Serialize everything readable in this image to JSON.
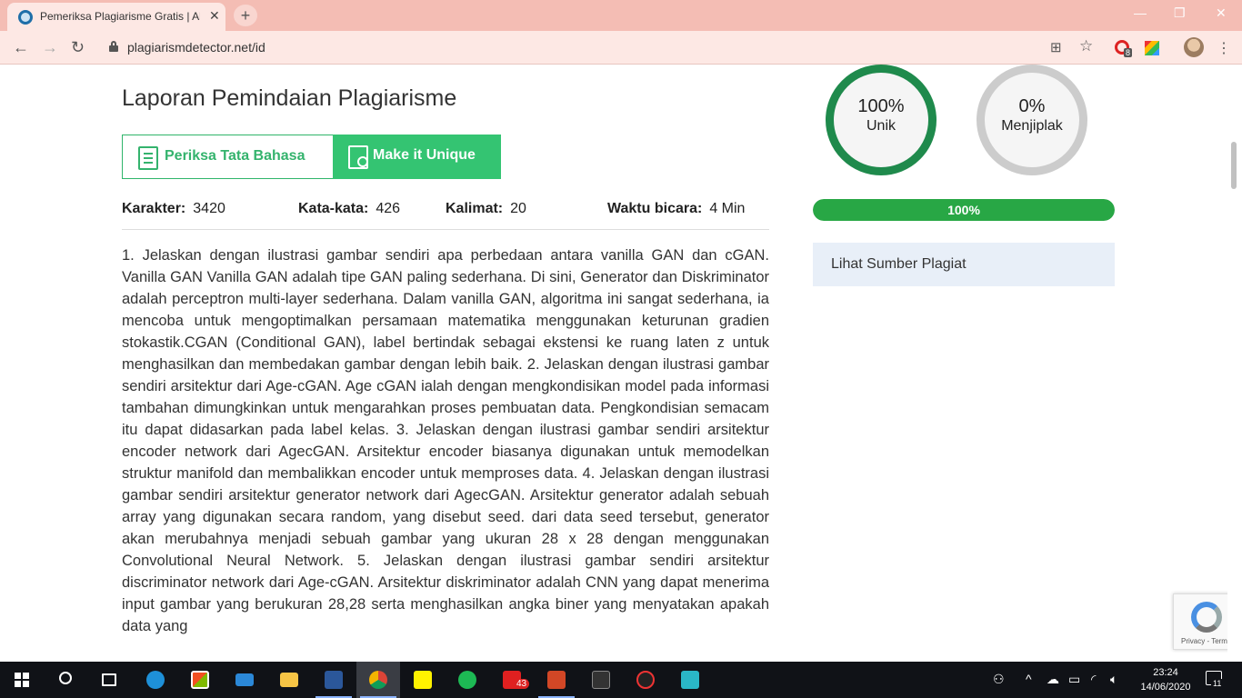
{
  "browser": {
    "tab_title": "Pemeriksa Plagiarisme Gratis | Akurat",
    "tab_close": "✕",
    "new_tab": "+",
    "url": "plagiarismdetector.net/id",
    "ext_badge": "8",
    "back": "←",
    "forward": "→",
    "reload": "↻",
    "star": "☆",
    "translate": "⊞",
    "kebab": "⋮",
    "min": "—",
    "max": "❐",
    "close": "✕"
  },
  "report": {
    "title": "Laporan Pemindaian Plagiarisme",
    "btn_grammar": "Periksa Tata Bahasa",
    "btn_unique": "Make it Unique",
    "stats": [
      {
        "label": "Karakter:",
        "value": "3420"
      },
      {
        "label": "Kata-kata:",
        "value": "426"
      },
      {
        "label": "Kalimat:",
        "value": "20"
      },
      {
        "label": "Waktu bicara:",
        "value": "4 Min"
      }
    ],
    "text": "1. Jelaskan dengan ilustrasi gambar sendiri apa perbedaan antara vanilla GAN dan cGAN. Vanilla GAN Vanilla GAN adalah tipe GAN paling sederhana. Di sini, Generator dan Diskriminator adalah perceptron multi-layer sederhana. Dalam vanilla GAN, algoritma ini sangat sederhana, ia mencoba untuk mengoptimalkan persamaan matematika menggunakan keturunan gradien stokastik.CGAN (Conditional GAN), label bertindak sebagai ekstensi ke ruang laten z untuk menghasilkan dan membedakan gambar dengan lebih baik. 2. Jelaskan dengan ilustrasi gambar sendiri arsitektur dari Age-cGAN. Age cGAN ialah dengan mengkondisikan model pada informasi tambahan dimungkinkan untuk mengarahkan proses pembuatan data. Pengkondisian semacam itu dapat didasarkan pada label kelas. 3. Jelaskan dengan ilustrasi gambar sendiri arsitektur encoder network dari AgecGAN. Arsitektur encoder biasanya digunakan untuk memodelkan struktur manifold dan membalikkan encoder untuk memproses data. 4. Jelaskan dengan ilustrasi gambar sendiri arsitektur generator network dari AgecGAN. Arsitektur generator adalah sebuah array yang digunakan secara random, yang disebut seed. dari data seed tersebut, generator akan merubahnya menjadi sebuah gambar yang ukuran 28 x 28 dengan menggunakan Convolutional Neural Network. 5. Jelaskan dengan ilustrasi gambar sendiri arsitektur discriminator network dari Age-cGAN. Arsitektur diskriminator adalah CNN yang dapat menerima input gambar yang berukuran 28,28 serta menghasilkan angka biner yang menyatakan apakah data yang"
  },
  "results": {
    "unique_pct": "100%",
    "unique_label": "Unik",
    "plag_pct": "0%",
    "plag_label": "Menjiplak",
    "progress_value": 1.0,
    "progress_text": "100%",
    "sources_label": "Lihat Sumber Plagiat",
    "unique_color": "#1f8a4c",
    "progress_color": "#28a745"
  },
  "recaptcha": {
    "terms": "Privacy - Terms"
  },
  "taskbar": {
    "mail_badge": "43",
    "time": "23:24",
    "date": "14/06/2020",
    "notif_count": "11",
    "tray_people": "⚇",
    "tray_chevron": "^",
    "tray_cloud": "☁",
    "tray_battery": "▭",
    "tray_wifi": "◜",
    "tray_volume": "🔈︎"
  }
}
